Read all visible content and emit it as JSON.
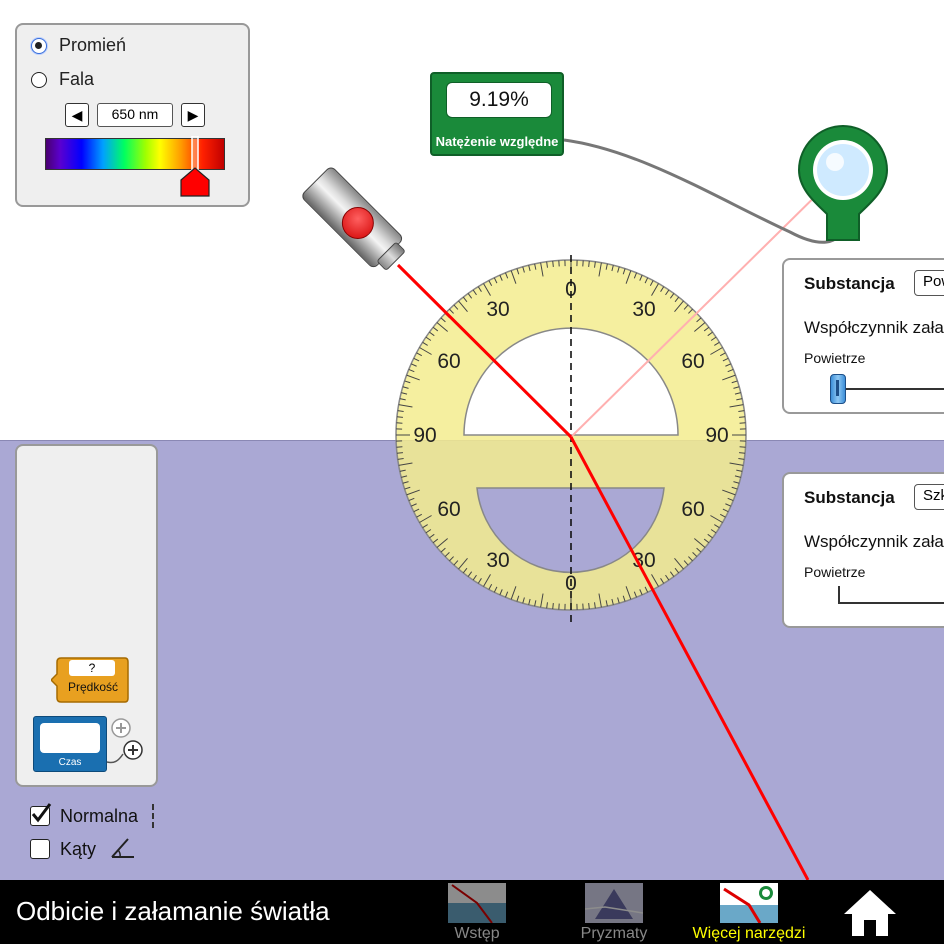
{
  "ray_panel": {
    "ray_label": "Promień",
    "wave_label": "Fala",
    "selected": "Promień",
    "wavelength": "650 nm",
    "wavelength_nm": 650
  },
  "intensity_meter": {
    "value": "9.19%",
    "label": "Natężenie względne"
  },
  "protractor": {
    "tick_labels": [
      "0",
      "30",
      "60",
      "90"
    ]
  },
  "top_medium": {
    "title": "Substancja",
    "selected": "Pow",
    "index_label": "Współczynnik zała",
    "slider_label": "Powietrze"
  },
  "bottom_medium": {
    "title": "Substancja",
    "selected": "Szk",
    "index_label": "Współczynnik zała",
    "slider_label": "Powietrze"
  },
  "toolbox": {
    "speed_value": "?",
    "speed_label": "Prędkość",
    "time_label": "Czas"
  },
  "options": {
    "normal_label": "Normalna",
    "normal_checked": true,
    "angles_label": "Kąty",
    "angles_checked": false
  },
  "footer": {
    "title": "Odbicie i załamanie światła",
    "tabs": [
      {
        "label": "Wstęp",
        "active": false
      },
      {
        "label": "Pryzmaty",
        "active": false
      },
      {
        "label": "Więcej narzędzi",
        "active": true
      }
    ]
  },
  "colors": {
    "lower_medium": "#aaa8d4",
    "laser_beam": "#ff0000",
    "reflected_beam": "#ffb0b0",
    "protractor": "#f3ec8e",
    "active_tab": "#ffff00",
    "meter_green": "#1a8a3a"
  }
}
